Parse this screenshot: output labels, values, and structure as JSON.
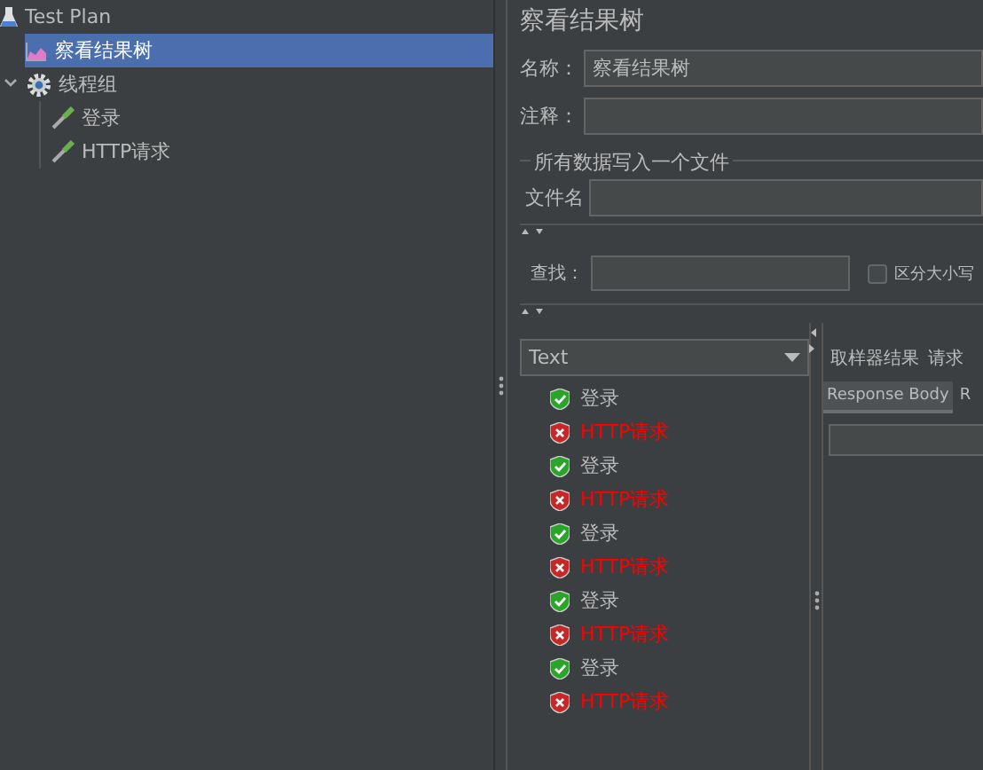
{
  "tree": [
    {
      "label": "Test Plan",
      "kind": "plan",
      "selected": false,
      "expanded": true,
      "children": [
        {
          "label": "察看结果树",
          "kind": "listener",
          "selected": true
        },
        {
          "label": "线程组",
          "kind": "thread-group",
          "selected": false,
          "expanded": true,
          "children": [
            {
              "label": "登录",
              "kind": "sampler",
              "selected": false
            },
            {
              "label": "HTTP请求",
              "kind": "sampler",
              "selected": false
            }
          ]
        }
      ]
    }
  ],
  "panel": {
    "title": "察看结果树",
    "name_label": "名称：",
    "name_value": "察看结果树",
    "comment_label": "注释：",
    "file_group": "所有数据写入一个文件",
    "file_label": "文件名",
    "search_label": "查找：",
    "case_label": "区分大小写",
    "case_checked": false
  },
  "renderer": {
    "value": "Text"
  },
  "results": [
    {
      "label": "登录",
      "success": true
    },
    {
      "label": "HTTP请求",
      "success": false
    },
    {
      "label": "登录",
      "success": true
    },
    {
      "label": "HTTP请求",
      "success": false
    },
    {
      "label": "登录",
      "success": true
    },
    {
      "label": "HTTP请求",
      "success": false
    },
    {
      "label": "登录",
      "success": true
    },
    {
      "label": "HTTP请求",
      "success": false
    },
    {
      "label": "登录",
      "success": true
    },
    {
      "label": "HTTP请求",
      "success": false
    }
  ],
  "result_tabs": [
    "取样器结果",
    "请求"
  ],
  "response_tabs": [
    {
      "label": "Response Body",
      "selected": true
    },
    {
      "label": "R",
      "selected": false
    }
  ]
}
